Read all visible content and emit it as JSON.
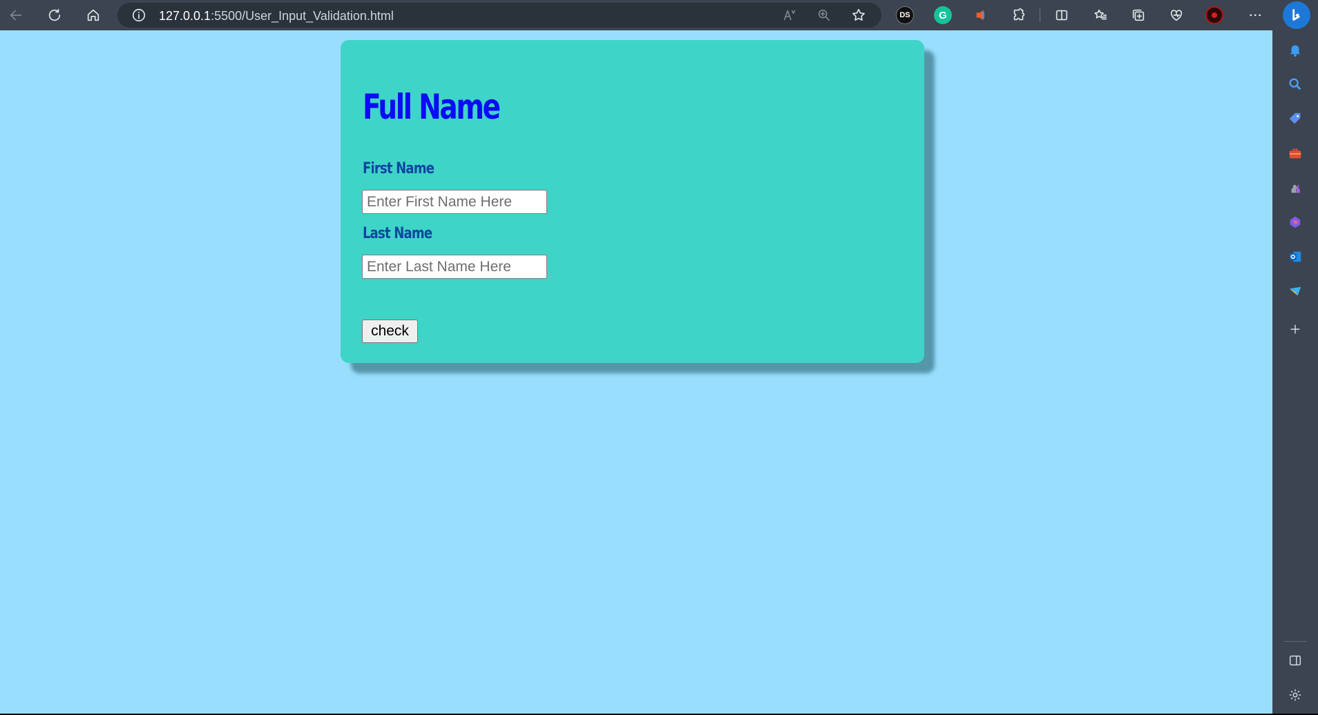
{
  "browser": {
    "url_host": "127.0.0.1",
    "url_rest": ":5500/User_Input_Validation.html",
    "extensions": {
      "ds": "DS",
      "grammarly": "G"
    }
  },
  "form": {
    "title": "Full Name",
    "first_name_label": "First Name",
    "first_name_placeholder": "Enter First Name Here",
    "last_name_label": "Last Name",
    "last_name_placeholder": "Enter Last Name Here",
    "check_button": "check"
  },
  "colors": {
    "page_background": "#99dffd",
    "card_background": "#3fd4c8",
    "title": "#0b0bf5",
    "label": "#0e47a0"
  }
}
